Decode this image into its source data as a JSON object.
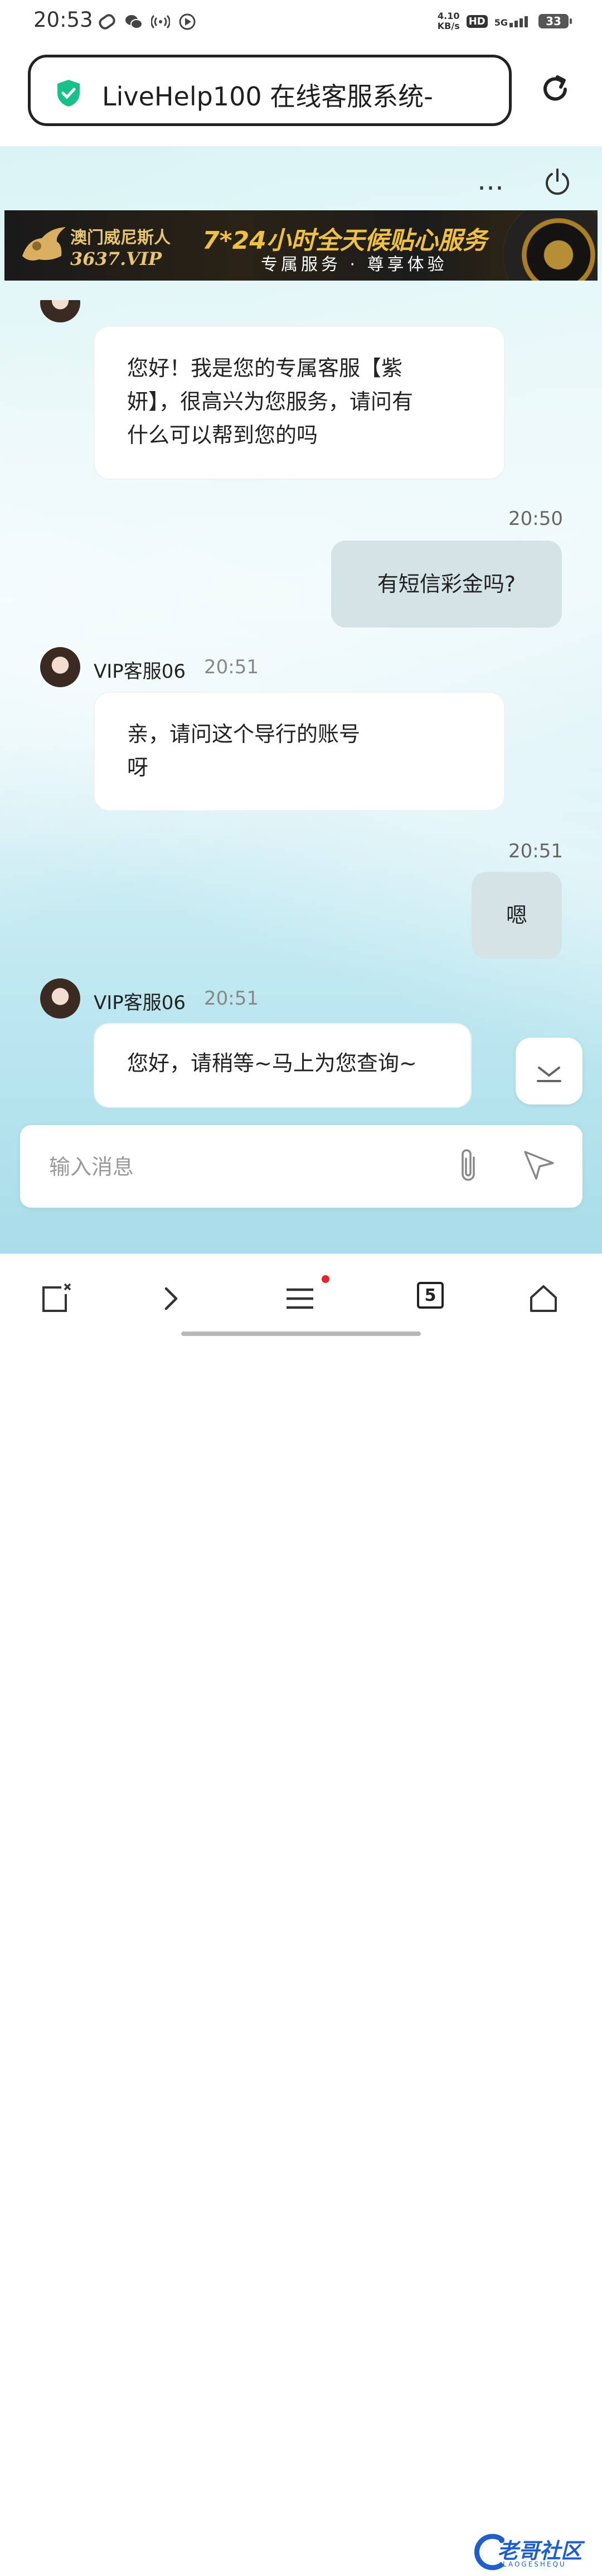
{
  "status_bar": {
    "time": "20:53",
    "net_speed_value": "4.10",
    "net_speed_unit": "KB/s",
    "hd_label": "HD",
    "network_label": "5G",
    "battery": "33"
  },
  "browser": {
    "page_title": "LiveHelp100 在线客服系统- …",
    "more_label": "…"
  },
  "banner": {
    "brand_line1": "澳门威尼斯人",
    "brand_line2": "3637.VIP",
    "headline": "7*24小时全天候贴心服务",
    "subline": "专属服务 · 尊享体验"
  },
  "messages": [
    {
      "side": "left",
      "text_lines": [
        "您好！我是您的专属客服【紫",
        "妍】，很高兴为您服务，请问有",
        "什么可以帮到您的吗"
      ]
    },
    {
      "side": "right",
      "time": "20:50",
      "text": "有短信彩金吗?"
    },
    {
      "side": "left",
      "sender": "VIP客服06",
      "time": "20:51",
      "text_lines": [
        "亲，请问这个导行的账号",
        "呀"
      ]
    },
    {
      "side": "right",
      "time": "20:51",
      "text": "嗯"
    },
    {
      "side": "left",
      "sender": "VIP客服06",
      "time": "20:51",
      "text_lines": [
        "您好，请稍等~马上为您查询~"
      ]
    }
  ],
  "input": {
    "placeholder": "输入消息",
    "value": ""
  },
  "bottom_nav": {
    "tabs_count": "5"
  },
  "watermark": {
    "text": "老哥社区",
    "sub": "LAOGESHEQU"
  },
  "colors": {
    "accent_green": "#19c08a",
    "right_bubble": "#d4e3e5",
    "notification_dot": "#e5242b"
  }
}
